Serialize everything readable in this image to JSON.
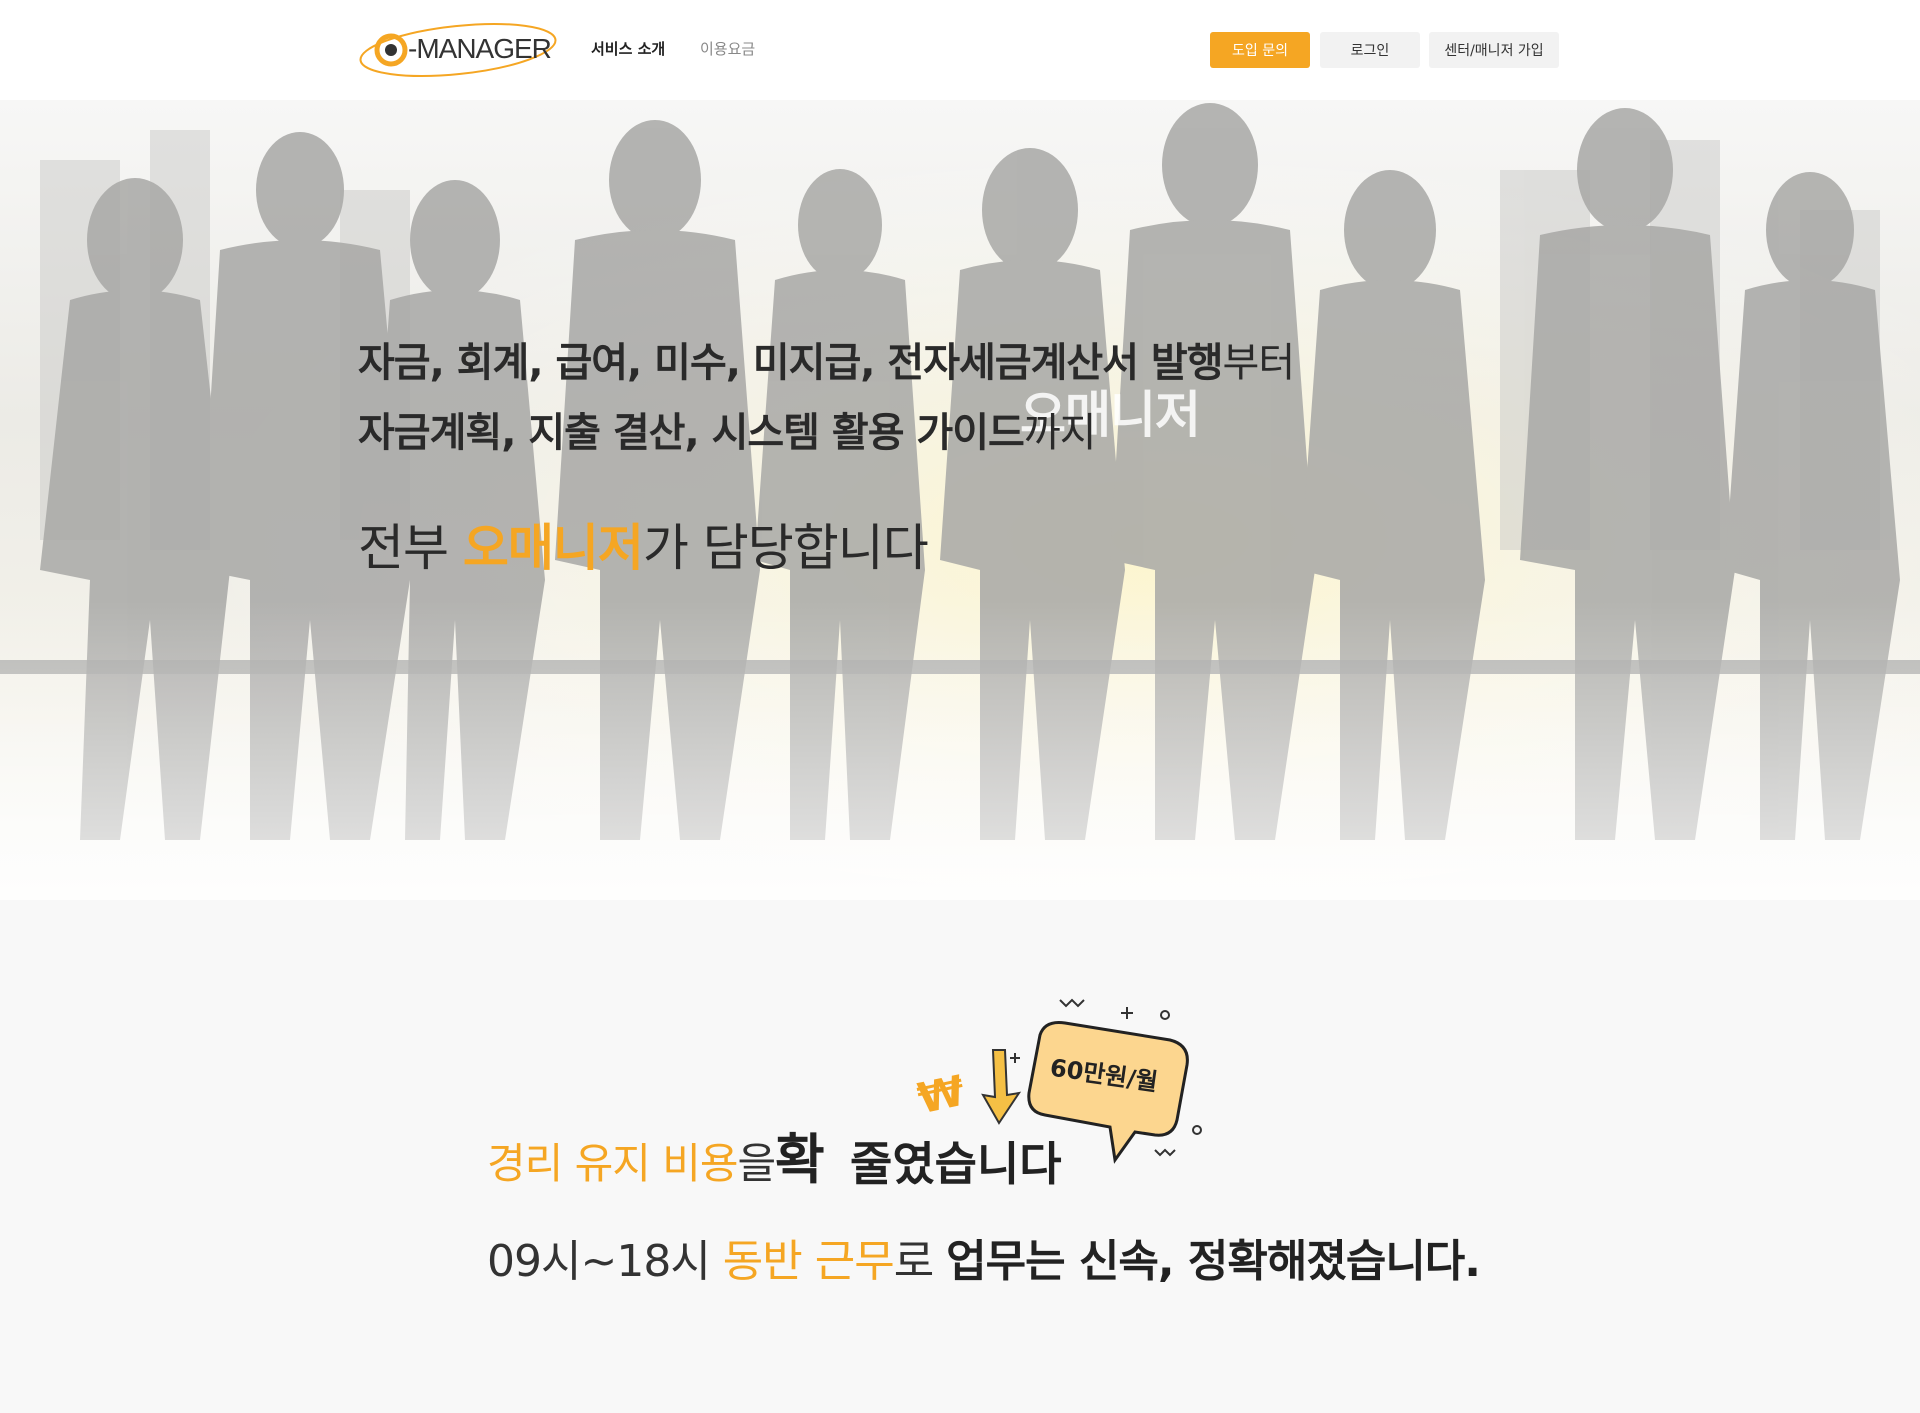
{
  "header": {
    "logo_text": "O-MANAGER",
    "nav": {
      "service": "서비스 소개",
      "pricing": "이용요금"
    },
    "buttons": {
      "inquiry": "도입 문의",
      "login": "로그인",
      "join": "센터/매니저 가입"
    },
    "accent_color": "#f5a623"
  },
  "hero": {
    "line1_bold": "자금, 회계, 급여, 미수, 미지급, 전자세금계산서 발행",
    "line1_light": "부터",
    "line2_bold": "자금계획, 지출 결산, 시스템 활용 가이드",
    "line2_light": "까지",
    "ghost_text": "오매니저",
    "line3_pre": "전부 ",
    "line3_accent": "오매니저",
    "line3_post": "가 담당합니다"
  },
  "cost": {
    "orange": "경리 유지 비용",
    "particle": "을",
    "big1": "확",
    "big2": "줄였습니다",
    "bubble": "60만원/월",
    "currency_icon": "won-icon"
  },
  "work": {
    "prefix": "09시~18시 ",
    "orange": "동반 근무",
    "particle": "로 ",
    "bold": "업무는 신속, 정확해졌습니다."
  }
}
